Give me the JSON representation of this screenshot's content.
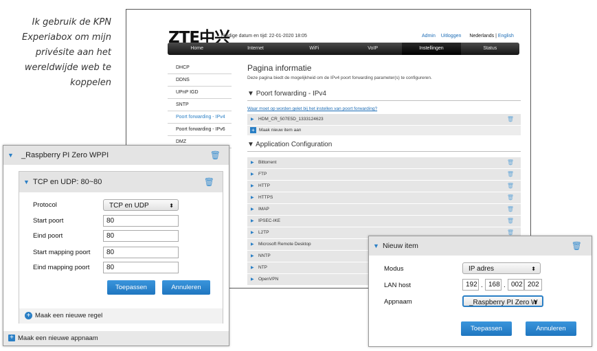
{
  "caption": {
    "lines": [
      "Ik gebruik de KPN",
      "Experiabox om mijn",
      "privésite aan het",
      "wereldwijde web te",
      "koppelen"
    ]
  },
  "router": {
    "logo": "ZTE中兴",
    "datum": "Huidige datum en tijd: 22-01-2020 18:05",
    "toplinks": {
      "admin": "Admin",
      "uitloggen": "Uitloggen",
      "nl": "Nederlands",
      "sep": "|",
      "en": "English"
    },
    "nav": [
      "Home",
      "Internet",
      "WiFi",
      "VoIP",
      "Instellingen",
      "Status"
    ],
    "sidebar": [
      "DHCP",
      "DDNS",
      "UPnP IGD",
      "SNTP",
      "Poort forwarding - IPv4",
      "Poort forwarding - IPv6",
      "DMZ"
    ],
    "page_title": "Pagina informatie",
    "page_desc": "Deze pagina biedt de mogelijkheid om de IPv4 poort forwarding parameter(s) te configureren.",
    "section1": {
      "title": "Poort forwarding - IPv4",
      "help_link": "Waar moet op worden gelet bij het instellen van poort forwarding?",
      "rows": [
        "HDM_CR_507E5D_1333124623"
      ],
      "add_label": "Maak nieuw item aan"
    },
    "section2": {
      "title": "Application Configuration",
      "rows": [
        "Bittorrent",
        "FTP",
        "HTTP",
        "HTTPS",
        "IMAP",
        "IPSEC-IKE",
        "L2TP",
        "Microsoft Remote Desktop",
        "NNTP",
        "NTP",
        "OpenVPN"
      ]
    }
  },
  "left_panel": {
    "title": "_Raspberry PI Zero WPPI",
    "sub_title": "TCP en UDP: 80~80",
    "fields": {
      "protocol": {
        "label": "Protocol",
        "value": "TCP en UDP"
      },
      "start_poort": {
        "label": "Start poort",
        "value": "80"
      },
      "eind_poort": {
        "label": "Eind poort",
        "value": "80"
      },
      "start_mapping": {
        "label": "Start mapping poort",
        "value": "80"
      },
      "eind_mapping": {
        "label": "Eind mapping poort",
        "value": "80"
      }
    },
    "apply_label": "Toepassen",
    "cancel_label": "Annuleren",
    "add_rule_label": "Maak een nieuwe regel",
    "add_app_label": "Maak een nieuwe appnaam"
  },
  "right_panel": {
    "title": "Nieuw item",
    "modus": {
      "label": "Modus",
      "value": "IP adres"
    },
    "lan_host": {
      "label": "LAN host",
      "octets": [
        "192",
        "168",
        "002",
        "202"
      ]
    },
    "appnaam": {
      "label": "Appnaam",
      "value": "_Raspberry PI Zero W"
    },
    "apply_label": "Toepassen",
    "cancel_label": "Annuleren"
  },
  "colors": {
    "accent": "#2a7fc5",
    "nav_dark": "#1a1a1a"
  }
}
